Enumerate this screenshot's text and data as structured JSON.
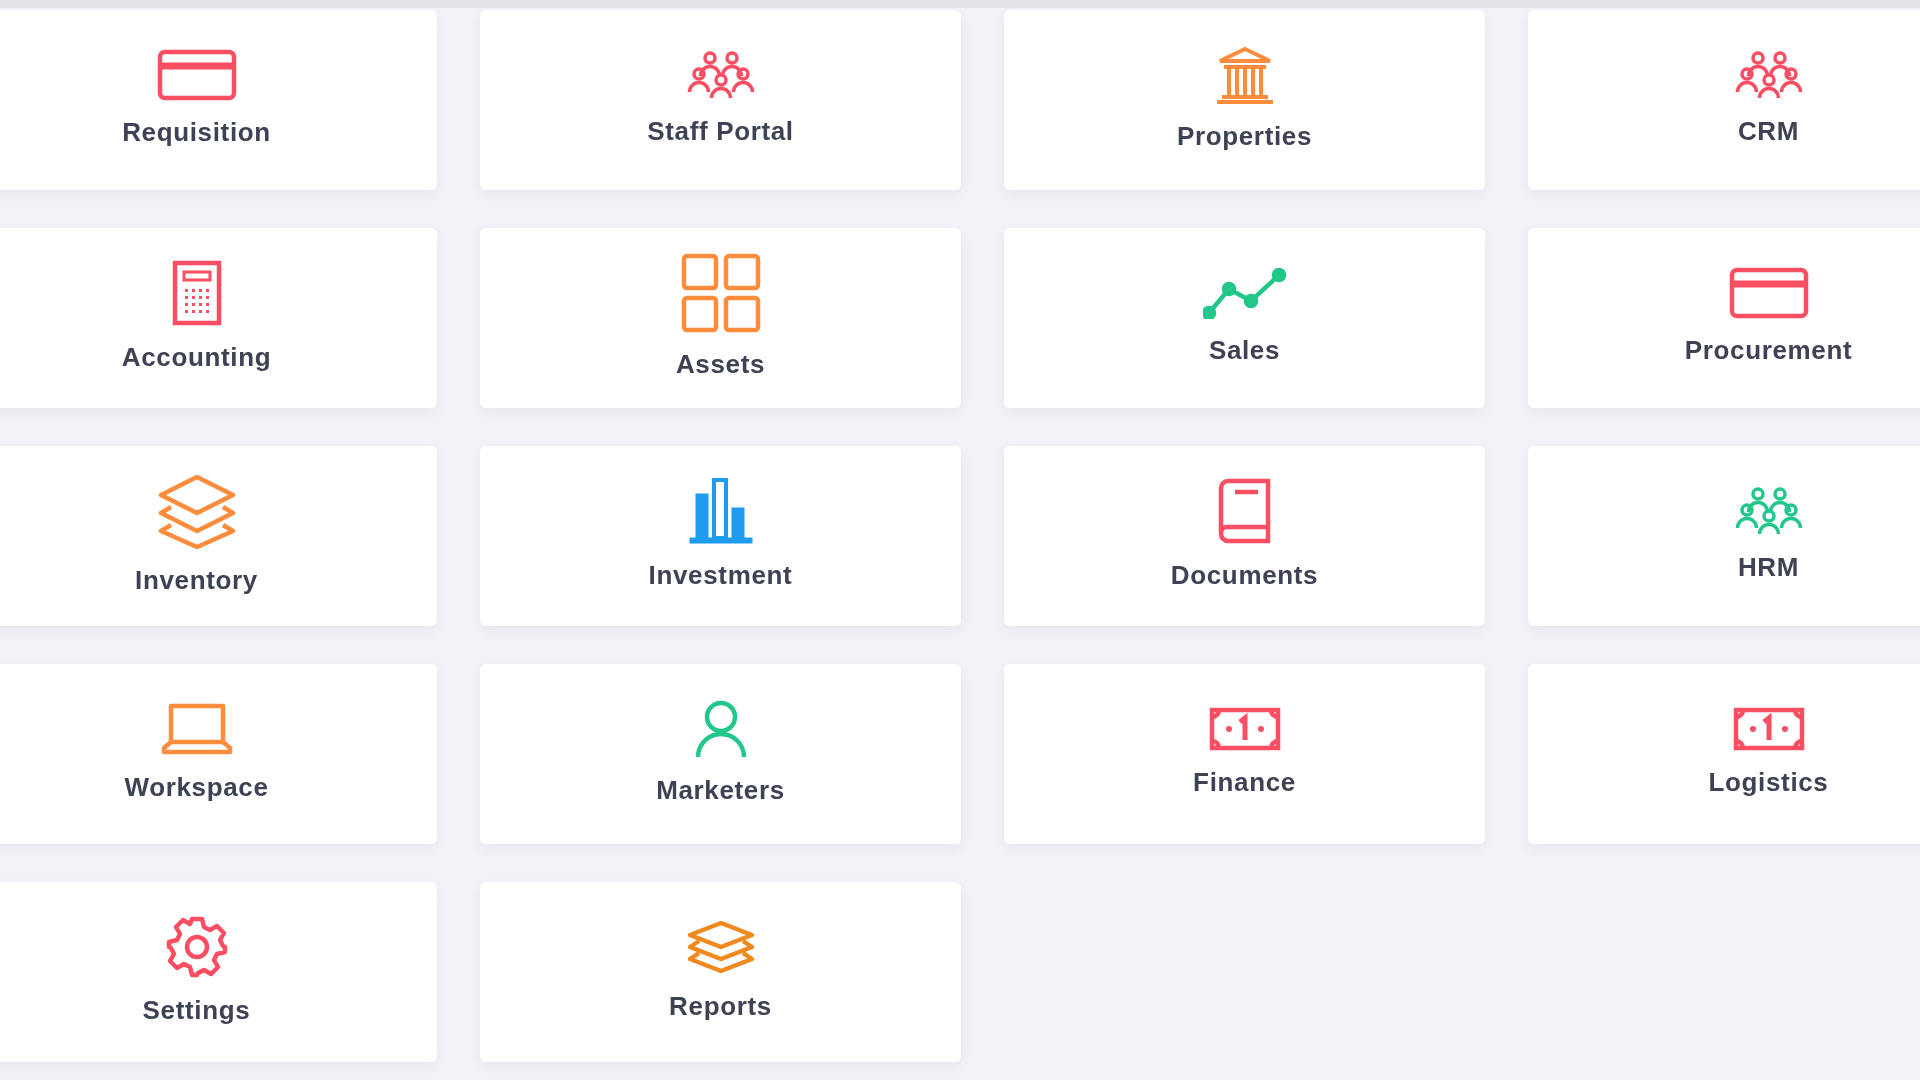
{
  "modules": [
    {
      "label": "Requisition",
      "kind": "card",
      "color": "#fb4e63"
    },
    {
      "label": "Staff Portal",
      "kind": "group",
      "color": "#fb4e63"
    },
    {
      "label": "Properties",
      "kind": "bank",
      "color": "#fd8c3c"
    },
    {
      "label": "CRM",
      "kind": "group",
      "color": "#fb4e63"
    },
    {
      "label": "Accounting",
      "kind": "calculator",
      "color": "#fb4e63"
    },
    {
      "label": "Assets",
      "kind": "grid",
      "color": "#fd8c3c"
    },
    {
      "label": "Sales",
      "kind": "trend",
      "color": "#22c78a"
    },
    {
      "label": "Procurement",
      "kind": "card",
      "color": "#fb4e63"
    },
    {
      "label": "Inventory",
      "kind": "layers",
      "color": "#fd8c3c"
    },
    {
      "label": "Investment",
      "kind": "bars",
      "color": "#1f9bef"
    },
    {
      "label": "Documents",
      "kind": "book",
      "color": "#fb4e63"
    },
    {
      "label": "HRM",
      "kind": "group",
      "color": "#22c78a"
    },
    {
      "label": "Workspace",
      "kind": "laptop",
      "color": "#fd8c3c"
    },
    {
      "label": "Marketers",
      "kind": "user",
      "color": "#22c78a"
    },
    {
      "label": "Finance",
      "kind": "money",
      "color": "#fb4e63"
    },
    {
      "label": "Logistics",
      "kind": "money",
      "color": "#fb4e63"
    },
    {
      "label": "Settings",
      "kind": "gear",
      "color": "#fb4e63"
    },
    {
      "label": "Reports",
      "kind": "stack",
      "color": "#f08a1e"
    }
  ]
}
